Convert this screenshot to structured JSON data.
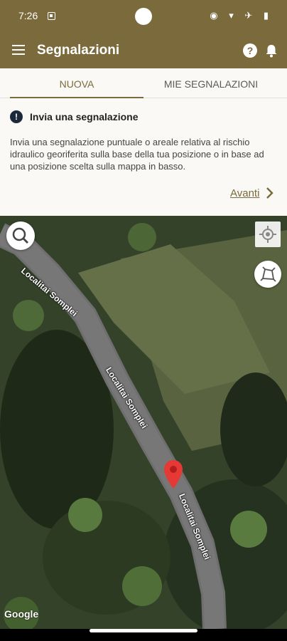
{
  "status": {
    "time": "7:26",
    "icons": "◉ ▾ ✈ ▮"
  },
  "appbar": {
    "title": "Segnalazioni",
    "help": "?"
  },
  "tabs": [
    {
      "label": "NUOVA"
    },
    {
      "label": "MIE SEGNALAZIONI"
    }
  ],
  "info": {
    "icon": "!",
    "title": "Invia una segnalazione",
    "text": "Invia una segnalazione puntuale o areale relativa al rischio idraulico georiferita sulla base della tua posizione o in base ad una posizione scelta sulla mappa in basso.",
    "next_label": "Avanti"
  },
  "map": {
    "road_labels": [
      "Localitai Somplei",
      "Localitai Somplei",
      "Localitai Somplei"
    ],
    "attribution": "Google"
  },
  "colors": {
    "brand": "#7a6a3c",
    "marker": "#e53935"
  }
}
